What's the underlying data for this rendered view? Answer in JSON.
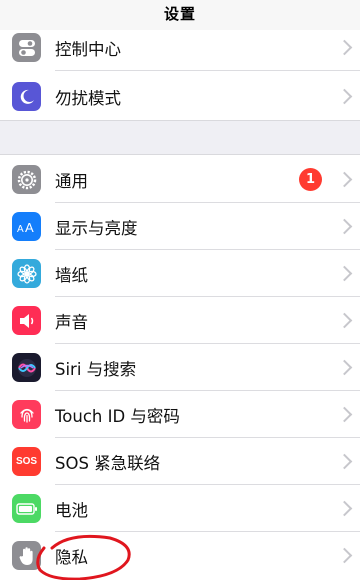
{
  "header": {
    "title": "设置"
  },
  "group1": [
    {
      "label": "控制中心",
      "icon": "control-center-icon",
      "color": "#8e8e93"
    },
    {
      "label": "勿扰模式",
      "icon": "moon-icon",
      "color": "#5856d6"
    }
  ],
  "group2": [
    {
      "label": "通用",
      "icon": "gear-icon",
      "color": "#8e8e93",
      "badge": "1"
    },
    {
      "label": "显示与亮度",
      "icon": "text-size-icon",
      "color": "#147efb"
    },
    {
      "label": "墙纸",
      "icon": "flower-icon",
      "color": "#34aadc"
    },
    {
      "label": "声音",
      "icon": "speaker-icon",
      "color": "#ff2d55"
    },
    {
      "label": "Siri 与搜索",
      "icon": "siri-icon",
      "color": "#1a1a2e"
    },
    {
      "label": "Touch ID 与密码",
      "icon": "fingerprint-icon",
      "color": "#ff3b5c"
    },
    {
      "label": "SOS 紧急联络",
      "icon": "sos-icon",
      "color": "#ff3b30",
      "icon_text": "SOS"
    },
    {
      "label": "电池",
      "icon": "battery-icon",
      "color": "#4cd964"
    },
    {
      "label": "隐私",
      "icon": "hand-icon",
      "color": "#8e8e93"
    }
  ],
  "colors": {
    "annotation": "#e0161e",
    "badge": "#ff3b30"
  }
}
